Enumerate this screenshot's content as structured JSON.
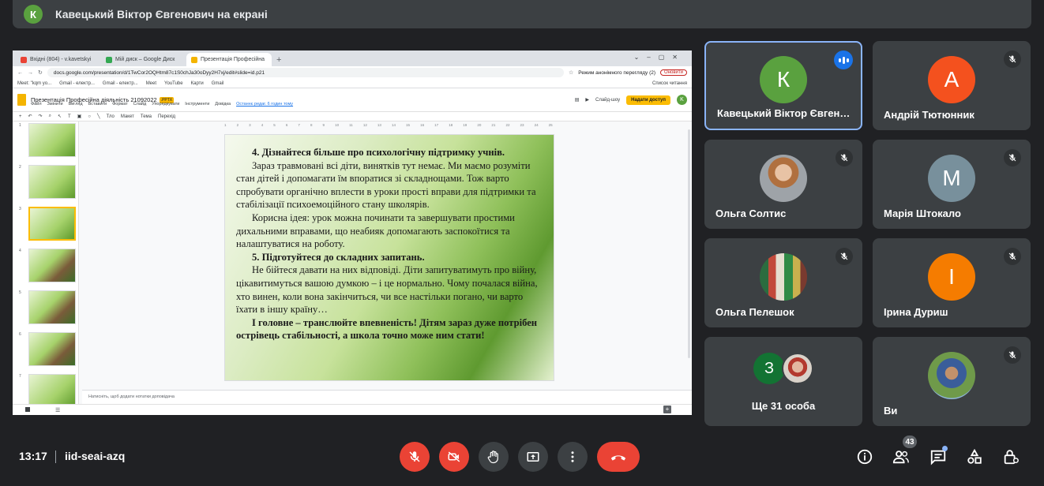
{
  "banner": {
    "avatar_letter": "К",
    "title": "Кавецький Віктор Євгенович на екрані"
  },
  "browser": {
    "tabs": [
      {
        "label": "Вхідні (804) - v.kavetskyi"
      },
      {
        "label": "Мій диск – Google Диск"
      },
      {
        "label": "Презентація Професійна"
      }
    ],
    "url": "docs.google.com/presentation/d/1TwCor2OQHtm87c1S0chJa30oDyy2H7xj/edit#slide=id.p21",
    "incognito_label": "Режим анонімного перегляду (2)",
    "update_label": "Оновити",
    "bookmarks": [
      "Meet: \"kqm yo...",
      "Gmail - електр...",
      "Gmail - електр...",
      "Meet",
      "YouTube",
      "Карти",
      "Gmail"
    ],
    "reading_list": "Список читання"
  },
  "doc": {
    "title": "Презентація Професійна діяльність 21092022",
    "format_badge": ".PPTX",
    "menu": [
      "Файл",
      "Змінити",
      "Вигляд",
      "Вставити",
      "Формат",
      "Слайд",
      "Упорядкувати",
      "Інструменти",
      "Довідка"
    ],
    "last_edit": "Останнє редаг. 6 годин тому",
    "slideshow_label": "Слайд-шоу",
    "access_label": "Надати доступ",
    "user_letter": "K",
    "toolbar": [
      "Тло",
      "Макет",
      "Тема",
      "Перехід"
    ],
    "notes_placeholder": "Натисніть, щоб додати нотатки доповідача",
    "thumb_numbers": [
      "1",
      "2",
      "3",
      "4",
      "5",
      "6",
      "7"
    ],
    "ruler": [
      "1",
      "2",
      "3",
      "4",
      "5",
      "6",
      "7",
      "8",
      "9",
      "10",
      "11",
      "12",
      "13",
      "14",
      "15",
      "16",
      "17",
      "18",
      "19",
      "20",
      "21",
      "22",
      "23",
      "24",
      "25"
    ]
  },
  "slide": {
    "h4": "4. Дізнайтеся більше про психологічну підтримку учнів.",
    "p1": "Зараз травмовані всі діти, винятків тут немає. Ми маємо розуміти стан дітей і допомагати їм впоратися зі складнощами. Тож варто спробувати органічно вплести в уроки прості вправи для підтримки та стабілізації психоемоційного стану школярів.",
    "p2": "Корисна ідея: урок можна починати та завершувати простими дихальними вправами, що неабияк допомагають заспокоїтися та налаштуватися на роботу.",
    "h5": "5. Підготуйтеся до складних запитань.",
    "p3": "Не бійтеся давати на них відповіді. Діти запитуватимуть про війну, цікавитимуться вашою думкою – і це нормально. Чому почалася війна, хто винен, коли вона закінчиться, чи все настільки погано, чи варто їхати в іншу країну…",
    "p4": "І головне – транслюйте впевненість! Дітям зараз дуже потрібен острівець стабільності, а школа точно може ним стати!"
  },
  "participants": [
    {
      "name": "Кавецький Віктор Євген…",
      "letter": "К",
      "color": "#5aa13f"
    },
    {
      "name": "Андрій Тютюнник",
      "letter": "А",
      "color": "#f4511e"
    },
    {
      "name": "Ольга Солтис"
    },
    {
      "name": "Марія Штокало",
      "letter": "М",
      "color": "#78909c"
    },
    {
      "name": "Ольга Пелешок"
    },
    {
      "name": "Ірина Дуриш",
      "letter": "І",
      "color": "#f57c00"
    },
    {
      "name": "Ви"
    }
  ],
  "more": {
    "letter": "З",
    "label": "Ще 31 особа"
  },
  "controls": {
    "time": "13:17",
    "meeting_code": "iid-seai-azq",
    "participants_count": "43"
  },
  "colors": {
    "meet_bg": "#202124",
    "tile_bg": "#3c4043",
    "danger": "#ea4335",
    "speaking": "#1a73e8"
  }
}
